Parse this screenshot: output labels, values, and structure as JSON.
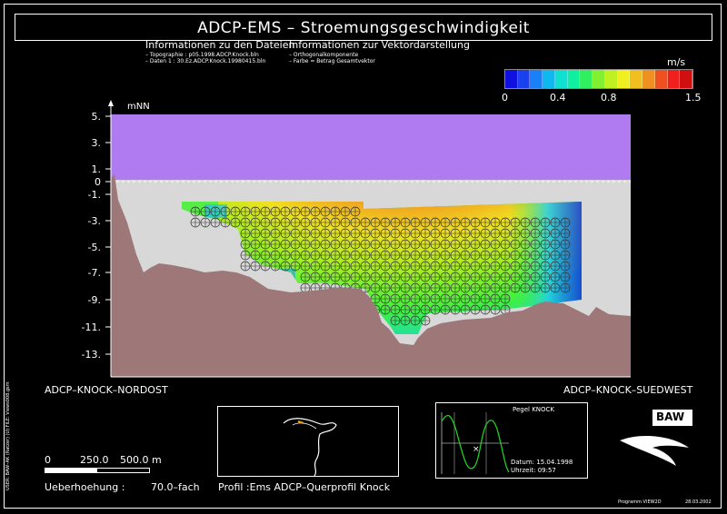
{
  "title": "ADCP-EMS – Stroemungsgeschwindigkeit",
  "info_left": {
    "heading": "Informationen zu den Dateien",
    "lines": [
      "– Topographie :    p05.1998.ADCP.Knock.bln",
      "– Daten 1 :    30.Ez.ADCP.Knock.19980415.bln"
    ]
  },
  "info_right": {
    "heading": "Informationen zur Vektordarstellung",
    "lines": [
      "– Orthogonalkomponente",
      "– Farbe = Betrag Gesamtvektor"
    ]
  },
  "colorbar": {
    "unit": "m/s",
    "tick_labels": [
      "0",
      "0.4",
      "0.8",
      "1.5"
    ],
    "colors": [
      "#1010e0",
      "#1a40f0",
      "#1a80f8",
      "#10b8f0",
      "#10e0d0",
      "#10f0a0",
      "#30f060",
      "#80f030",
      "#c0f020",
      "#f0f020",
      "#f0c020",
      "#f09020",
      "#f05020",
      "#f02020",
      "#d01010"
    ]
  },
  "chart_data": {
    "type": "heatmap",
    "title": "ADCP-EMS – Stroemungsgeschwindigkeit",
    "ylabel": "mNN",
    "y_ticks": [
      "5.",
      "3.",
      "1.",
      "0",
      "-1.",
      "-3.",
      "-5.",
      "-7.",
      "-9.",
      "-11.",
      "-13."
    ],
    "ylim": [
      -14,
      6
    ],
    "water_level": 0,
    "x_left_label": "ADCP–KNOCK–NORDOST",
    "x_right_label": "ADCP–KNOCK–SUEDWEST",
    "colorscale": {
      "unit": "m/s",
      "min": 0,
      "max": 1.5
    }
  },
  "scale_bar": {
    "labels": [
      "0",
      "250.0",
      "500.0 m"
    ]
  },
  "ueberhoehung": {
    "label": "Ueberhoehung :",
    "value": "70.0–fach"
  },
  "profil": "Profil :Ems ADCP–Querprofil Knock",
  "pegel": {
    "title": "Pegel KNOCK",
    "datum": "Datum:  15.04.1998",
    "uhrzeit": "Uhrzeit:  09:57"
  },
  "logo": "BAW",
  "side_text": "USER: BAW–AK (Ratzer) (U)     FILE: Views008.gsm",
  "footer": {
    "program": "Programm VIEW2D",
    "date": "28.03.2002"
  }
}
